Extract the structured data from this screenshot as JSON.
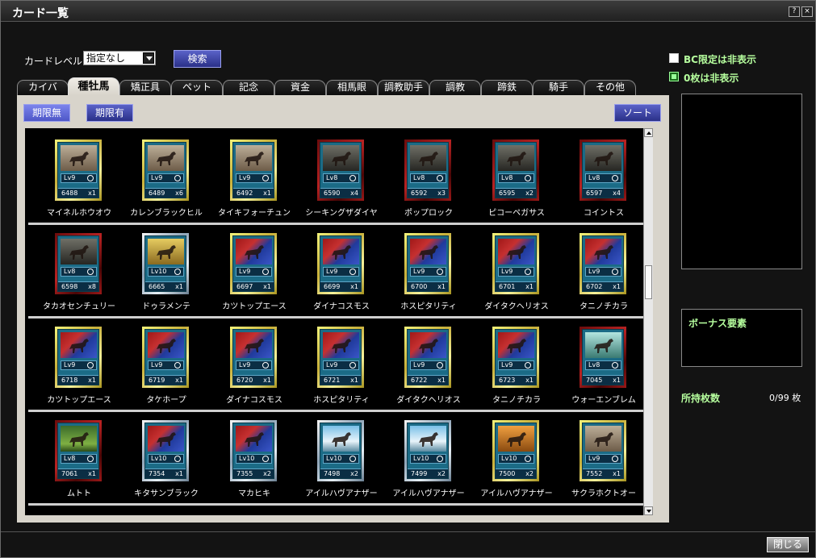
{
  "window": {
    "title": "カード一覧",
    "help_label": "?",
    "close_label": "×"
  },
  "filter": {
    "level_label": "カードレベル:",
    "level_value": "指定なし",
    "search_label": "検索"
  },
  "tabs": [
    {
      "label": "カイバ"
    },
    {
      "label": "種牡馬",
      "active": true
    },
    {
      "label": "矯正具"
    },
    {
      "label": "ペット"
    },
    {
      "label": "記念"
    },
    {
      "label": "資金"
    },
    {
      "label": "相馬眼"
    },
    {
      "label": "調教助手"
    },
    {
      "label": "調教"
    },
    {
      "label": "蹄鉄"
    },
    {
      "label": "騎手"
    },
    {
      "label": "その他"
    }
  ],
  "panel": {
    "no_limit_label": "期限無",
    "limit_label": "期限有",
    "sort_label": "ソート"
  },
  "cards": [
    {
      "name": "マイネルホウオウ",
      "level": "Lv9",
      "id": "6488",
      "count": "x1",
      "frame": "gold",
      "img": "photo"
    },
    {
      "name": "カレンブラックヒル",
      "level": "Lv9",
      "id": "6489",
      "count": "x6",
      "frame": "gold",
      "img": "photo"
    },
    {
      "name": "タイキフォーチュン",
      "level": "Lv9",
      "id": "6492",
      "count": "x1",
      "frame": "gold",
      "img": "photo"
    },
    {
      "name": "シーキングザダイヤ",
      "level": "Lv8",
      "id": "6590",
      "count": "x4",
      "frame": "red",
      "img": "dark"
    },
    {
      "name": "ポップロック",
      "level": "Lv8",
      "id": "6592",
      "count": "x3",
      "frame": "red",
      "img": "dark"
    },
    {
      "name": "ピコーペガサス",
      "level": "Lv8",
      "id": "6595",
      "count": "x2",
      "frame": "red",
      "img": "dark"
    },
    {
      "name": "コイントス",
      "level": "Lv8",
      "id": "6597",
      "count": "x4",
      "frame": "red",
      "img": "dark"
    },
    {
      "name": "タカオセンチュリー",
      "level": "Lv8",
      "id": "6598",
      "count": "x8",
      "frame": "red",
      "img": "dark"
    },
    {
      "name": "ドゥラメンテ",
      "level": "Lv10",
      "id": "6665",
      "count": "x1",
      "frame": "silver",
      "img": "gold"
    },
    {
      "name": "カツトップエース",
      "level": "Lv9",
      "id": "6697",
      "count": "x1",
      "frame": "gold",
      "img": "blue"
    },
    {
      "name": "ダイナコスモス",
      "level": "Lv9",
      "id": "6699",
      "count": "x1",
      "frame": "gold",
      "img": "blue"
    },
    {
      "name": "ホスピタリティ",
      "level": "Lv9",
      "id": "6700",
      "count": "x1",
      "frame": "gold",
      "img": "blue"
    },
    {
      "name": "ダイタクヘリオス",
      "level": "Lv9",
      "id": "6701",
      "count": "x1",
      "frame": "gold",
      "img": "blue"
    },
    {
      "name": "タニノチカラ",
      "level": "Lv9",
      "id": "6702",
      "count": "x1",
      "frame": "gold",
      "img": "blue"
    },
    {
      "name": "カツトップエース",
      "level": "Lv9",
      "id": "6718",
      "count": "x1",
      "frame": "gold",
      "img": "blue"
    },
    {
      "name": "タケホープ",
      "level": "Lv9",
      "id": "6719",
      "count": "x1",
      "frame": "gold",
      "img": "blue"
    },
    {
      "name": "ダイナコスモス",
      "level": "Lv9",
      "id": "6720",
      "count": "x1",
      "frame": "gold",
      "img": "blue"
    },
    {
      "name": "ホスピタリティ",
      "level": "Lv9",
      "id": "6721",
      "count": "x1",
      "frame": "gold",
      "img": "blue"
    },
    {
      "name": "ダイタクヘリオス",
      "level": "Lv9",
      "id": "6722",
      "count": "x1",
      "frame": "gold",
      "img": "blue"
    },
    {
      "name": "タニノチカラ",
      "level": "Lv9",
      "id": "6723",
      "count": "x1",
      "frame": "gold",
      "img": "blue"
    },
    {
      "name": "ウォーエンブレム",
      "level": "Lv8",
      "id": "7045",
      "count": "x1",
      "frame": "red",
      "img": "teal"
    },
    {
      "name": "ムトト",
      "level": "Lv8",
      "id": "7061",
      "count": "x1",
      "frame": "red",
      "img": "green"
    },
    {
      "name": "キタサンブラック",
      "level": "Lv10",
      "id": "7354",
      "count": "x1",
      "frame": "silver",
      "img": "blue"
    },
    {
      "name": "マカヒキ",
      "level": "Lv10",
      "id": "7355",
      "count": "x2",
      "frame": "silver",
      "img": "blue"
    },
    {
      "name": "アイルハヴアナザー",
      "level": "Lv10",
      "id": "7498",
      "count": "x2",
      "frame": "silver",
      "img": "sky"
    },
    {
      "name": "アイルハヴアナザー",
      "level": "Lv10",
      "id": "7499",
      "count": "x2",
      "frame": "silver",
      "img": "sky"
    },
    {
      "name": "アイルハヴアナザー",
      "level": "Lv10",
      "id": "7500",
      "count": "x2",
      "frame": "gold",
      "img": "orange"
    },
    {
      "name": "サクラホクトオー",
      "level": "Lv9",
      "id": "7552",
      "count": "x1",
      "frame": "gold",
      "img": "photo"
    }
  ],
  "sidebar": {
    "bc_hidden_label": "BC限定は非表示",
    "bc_hidden_checked": false,
    "zero_hidden_label": "0枚は非表示",
    "zero_hidden_checked": true,
    "bonus_title": "ボーナス要素",
    "owned_label": "所持枚数",
    "owned_count": "0/99 枚"
  },
  "footer": {
    "close_label": "閉じる"
  },
  "colors": {
    "accent_green": "#b6ff9e",
    "button_blue": "#4e57c7"
  }
}
